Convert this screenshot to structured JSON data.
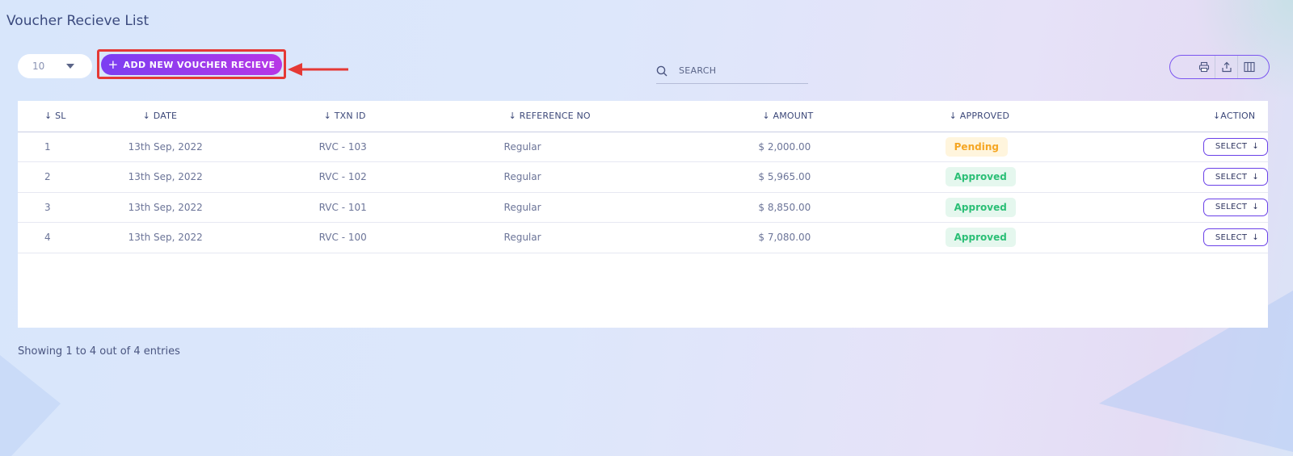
{
  "page": {
    "title": "Voucher Recieve List"
  },
  "toolbar": {
    "per_page_value": "10",
    "add_button_label": "ADD NEW VOUCHER RECIEVE",
    "add_icon": "plus-icon",
    "search_placeholder": "SEARCH",
    "tools": [
      "print-icon",
      "export-icon",
      "columns-icon"
    ]
  },
  "table": {
    "columns": [
      "SL",
      "DATE",
      "TXN ID",
      "REFERENCE NO",
      "AMOUNT",
      "APPROVED",
      "ACTION"
    ],
    "sort_icon": "arrow-down-icon",
    "rows": [
      {
        "sl": "1",
        "date": "13th Sep, 2022",
        "txn": "RVC - 103",
        "ref": "Regular",
        "amount": "$ 2,000.00",
        "status": "Pending",
        "action": "SELECT"
      },
      {
        "sl": "2",
        "date": "13th Sep, 2022",
        "txn": "RVC - 102",
        "ref": "Regular",
        "amount": "$ 5,965.00",
        "status": "Approved",
        "action": "SELECT"
      },
      {
        "sl": "3",
        "date": "13th Sep, 2022",
        "txn": "RVC - 101",
        "ref": "Regular",
        "amount": "$ 8,850.00",
        "status": "Approved",
        "action": "SELECT"
      },
      {
        "sl": "4",
        "date": "13th Sep, 2022",
        "txn": "RVC - 100",
        "ref": "Regular",
        "amount": "$ 7,080.00",
        "status": "Approved",
        "action": "SELECT"
      }
    ]
  },
  "footer": {
    "showing_text": "Showing 1 to 4 out of 4 entries"
  },
  "colors": {
    "accent": "#7b3ff2",
    "accent_end": "#b736e6",
    "highlight": "#e53935",
    "pending": "#f5a623",
    "approved": "#2bbf76"
  }
}
